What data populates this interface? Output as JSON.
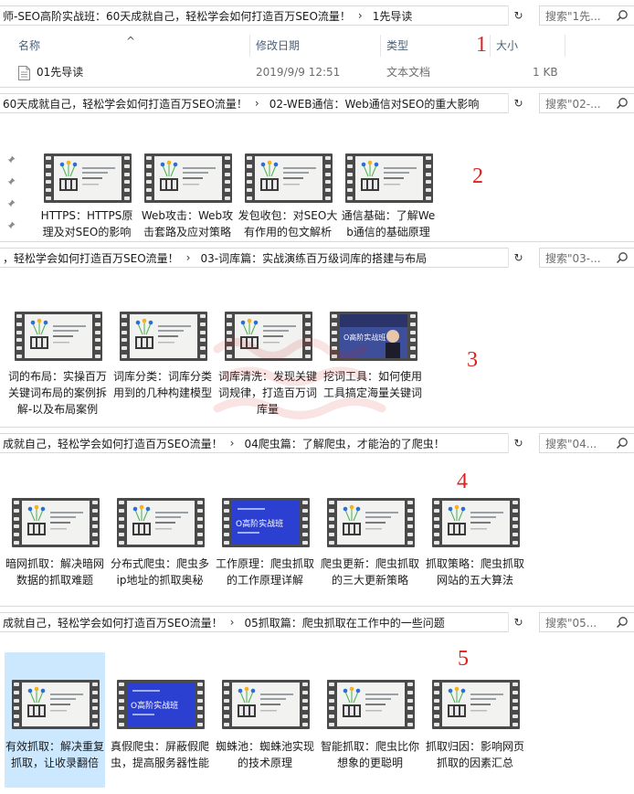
{
  "panels": [
    {
      "path": [
        "师-SEO高阶实战班：60天成就自己，轻松学会如何打造百万SEO流量！",
        "1先导读"
      ],
      "search_placeholder": "搜索\"1先...",
      "annotation": "1",
      "view": "details",
      "columns": {
        "name": "名称",
        "date": "修改日期",
        "type": "类型",
        "size": "大小"
      },
      "files": [
        {
          "name": "01先导读",
          "date": "2019/9/9 12:51",
          "type": "文本文档",
          "size": "1 KB"
        }
      ]
    },
    {
      "path": [
        "60天成就自己，轻松学会如何打造百万SEO流量！",
        "02-WEB通信：Web通信对SEO的重大影响"
      ],
      "search_placeholder": "搜索\"02-...",
      "annotation": "2",
      "view": "tiles",
      "items": [
        {
          "label": "HTTPS：HTTPS原理及对SEO的影响",
          "thumb": "white",
          "selected": false
        },
        {
          "label": "Web攻击：Web攻击套路及应对策略",
          "thumb": "white",
          "selected": false
        },
        {
          "label": "发包收包：对SEO大有作用的包文解析",
          "thumb": "white",
          "selected": false
        },
        {
          "label": "通信基础：了解Web通信的基础原理",
          "thumb": "white",
          "selected": false
        }
      ]
    },
    {
      "path": [
        "，轻松学会如何打造百万SEO流量！",
        "03-词库篇：实战演练百万级词库的搭建与布局"
      ],
      "search_placeholder": "搜索\"03-...",
      "annotation": "3",
      "view": "tiles",
      "items": [
        {
          "label": "词的布局：实操百万关键词布局的案例拆解-以及布局案例",
          "thumb": "white",
          "selected": false
        },
        {
          "label": "词库分类：词库分类用到的几种构建模型",
          "thumb": "white",
          "selected": false
        },
        {
          "label": "词库清洗：发现关键词规律，打造百万词库量",
          "thumb": "white",
          "selected": false
        },
        {
          "label": "挖词工具：如何使用工具搞定海量关键词",
          "thumb": "photo",
          "selected": false
        }
      ]
    },
    {
      "path": [
        "成就自己，轻松学会如何打造百万SEO流量！",
        "04爬虫篇：了解爬虫，才能治的了爬虫！"
      ],
      "search_placeholder": "搜索\"04...",
      "annotation": "4",
      "view": "tiles",
      "items": [
        {
          "label": "暗网抓取：解决暗网数据的抓取难题",
          "thumb": "white",
          "selected": false
        },
        {
          "label": "分布式爬虫：爬虫多ip地址的抓取奥秘",
          "thumb": "white",
          "selected": false
        },
        {
          "label": "工作原理：爬虫抓取的工作原理详解",
          "thumb": "blue",
          "selected": false
        },
        {
          "label": "爬虫更新：爬虫抓取的三大更新策略",
          "thumb": "white",
          "selected": false
        },
        {
          "label": "抓取策略：爬虫抓取网站的五大算法",
          "thumb": "white",
          "selected": false
        }
      ]
    },
    {
      "path": [
        "成就自己，轻松学会如何打造百万SEO流量！",
        "05抓取篇：爬虫抓取在工作中的一些问题"
      ],
      "search_placeholder": "搜索\"05...",
      "annotation": "5",
      "view": "tiles",
      "items": [
        {
          "label": "有效抓取：解决重复抓取，让收录翻倍",
          "thumb": "white",
          "selected": true
        },
        {
          "label": "真假爬虫：屏蔽假爬虫，提高服务器性能",
          "thumb": "blue",
          "selected": false
        },
        {
          "label": "蜘蛛池：蜘蛛池实现的技术原理",
          "thumb": "white",
          "selected": false
        },
        {
          "label": "智能抓取：爬虫比你想象的更聪明",
          "thumb": "white",
          "selected": false
        },
        {
          "label": "抓取归因：影响网页抓取的因素汇总",
          "thumb": "white",
          "selected": false
        }
      ]
    }
  ],
  "thumb_text": {
    "small": "SEO高阶实战班",
    "big": "O高阶实战班"
  },
  "colors": {
    "annotation": "#e02020",
    "selected": "#cce8ff",
    "accent_blue": "#2b3fd0"
  }
}
